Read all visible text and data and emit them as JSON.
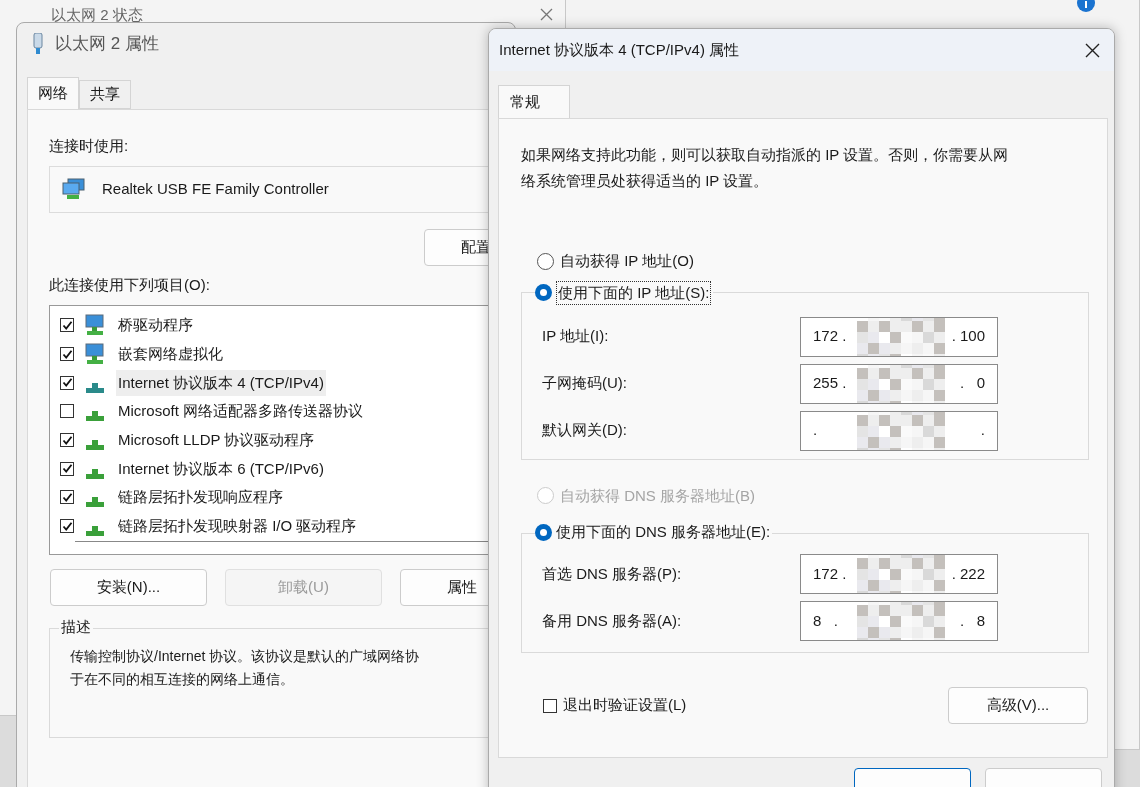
{
  "background_window": {
    "title": "以太网 2 状态"
  },
  "adapter_dialog": {
    "title": "以太网 2 属性",
    "tabs": [
      {
        "label": "网络",
        "selected": true
      },
      {
        "label": "共享",
        "selected": false
      }
    ],
    "connect_using_label": "连接时使用:",
    "adapter_name": "Realtek USB FE Family Controller",
    "configure_button": "配置",
    "items_label": "此连接使用下列项目(O):",
    "items": [
      {
        "label": "桥驱动程序",
        "checked": true,
        "selected": false,
        "kind": "client"
      },
      {
        "label": "嵌套网络虚拟化",
        "checked": true,
        "selected": false,
        "kind": "client"
      },
      {
        "label": "Internet 协议版本 4 (TCP/IPv4)",
        "checked": true,
        "selected": true,
        "kind": "protocol"
      },
      {
        "label": "Microsoft 网络适配器多路传送器协议",
        "checked": false,
        "selected": false,
        "kind": "protocol"
      },
      {
        "label": "Microsoft LLDP 协议驱动程序",
        "checked": true,
        "selected": false,
        "kind": "protocol"
      },
      {
        "label": "Internet 协议版本 6 (TCP/IPv6)",
        "checked": true,
        "selected": false,
        "kind": "protocol"
      },
      {
        "label": "链路层拓扑发现响应程序",
        "checked": true,
        "selected": false,
        "kind": "protocol"
      },
      {
        "label": "链路层拓扑发现映射器 I/O 驱动程序",
        "checked": true,
        "selected": false,
        "kind": "protocol"
      }
    ],
    "buttons": [
      {
        "label": "安装(N)...",
        "disabled": false
      },
      {
        "label": "卸载(U)",
        "disabled": true
      },
      {
        "label": "属性",
        "disabled": false
      }
    ],
    "description": {
      "title": "描述",
      "lines": [
        "传输控制协议/Internet 协议。该协议是默认的广域网络协",
        "于在不同的相互连接的网络上通信。"
      ]
    }
  },
  "ipv4_dialog": {
    "title": "Internet 协议版本 4 (TCP/IPv4) 属性",
    "tabs": [
      {
        "label": "常规",
        "selected": true
      }
    ],
    "intro": [
      "如果网络支持此功能，则可以获取自动指派的 IP 设置。否则，你需要从网",
      "络系统管理员处获得适当的 IP 设置。"
    ],
    "ip_options": [
      {
        "label": "自动获得 IP 地址(O)",
        "selected": false,
        "disabled": false
      },
      {
        "label": "使用下面的 IP 地址(S):",
        "selected": true,
        "disabled": false
      }
    ],
    "ip_fields": [
      {
        "label": "IP 地址(I):",
        "first": "172 .",
        "last": ". 100"
      },
      {
        "label": "子网掩码(U):",
        "first": "255 .",
        "last": ".   0"
      },
      {
        "label": "默认网关(D):",
        "first": ".",
        "last": "."
      }
    ],
    "dns_options": [
      {
        "label": "自动获得 DNS 服务器地址(B)",
        "selected": false,
        "disabled": true
      },
      {
        "label": "使用下面的 DNS 服务器地址(E):",
        "selected": true,
        "disabled": false
      }
    ],
    "dns_fields": [
      {
        "label": "首选 DNS 服务器(P):",
        "first": "172 .",
        "last": ". 222"
      },
      {
        "label": "备用 DNS 服务器(A):",
        "first": "8   .",
        "last": ".   8"
      }
    ],
    "validate_checkbox": {
      "label": "退出时验证设置(L)",
      "checked": false
    },
    "advanced_button": "高级(V)..."
  }
}
